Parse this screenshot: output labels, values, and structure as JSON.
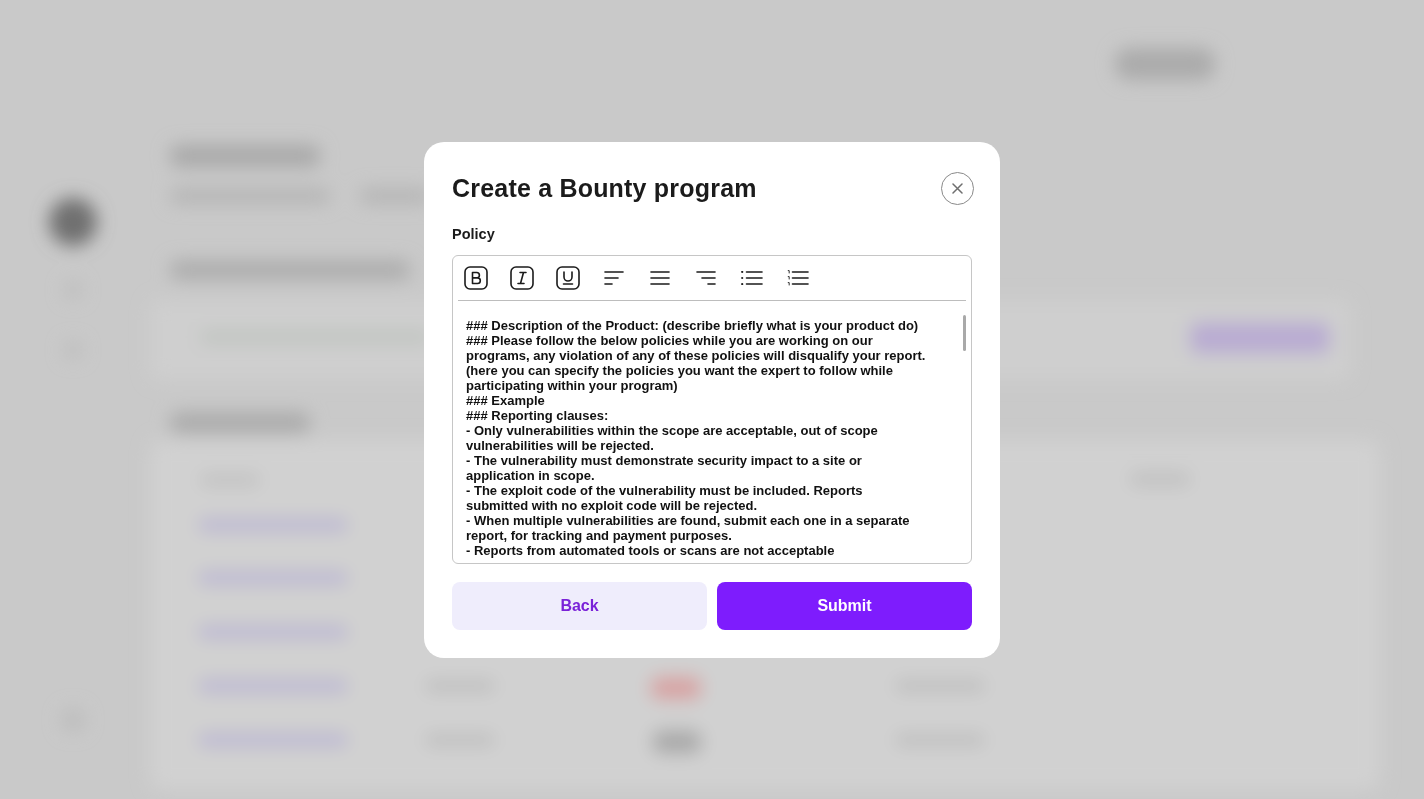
{
  "dialog": {
    "title": "Create a Bounty program"
  },
  "policy": {
    "label": "Policy",
    "lines": [
      "### Description of the Product: (describe briefly what is your product do)",
      "### Please follow the below policies while you are working on our",
      "programs, any violation of any of these policies will disqualify your report.",
      "(here you can specify the policies you want the expert to follow while",
      "participating within your program)",
      "### Example",
      "### Reporting clauses:",
      "- Only vulnerabilities within the scope are acceptable, out of scope",
      "vulnerabilities will be rejected.",
      "- The vulnerability must demonstrate security impact to a site or",
      "application in scope.",
      "- The exploit code of the vulnerability must be included. Reports",
      "submitted with no exploit code will be rejected.",
      "- When multiple vulnerabilities are found, submit each one in a separate",
      "report, for tracking and payment purposes.",
      "- Reports from automated tools or scans are not acceptable"
    ]
  },
  "buttons": [
    {
      "label": "Back",
      "kind": "secondary"
    },
    {
      "label": "Submit",
      "kind": "primary"
    }
  ]
}
